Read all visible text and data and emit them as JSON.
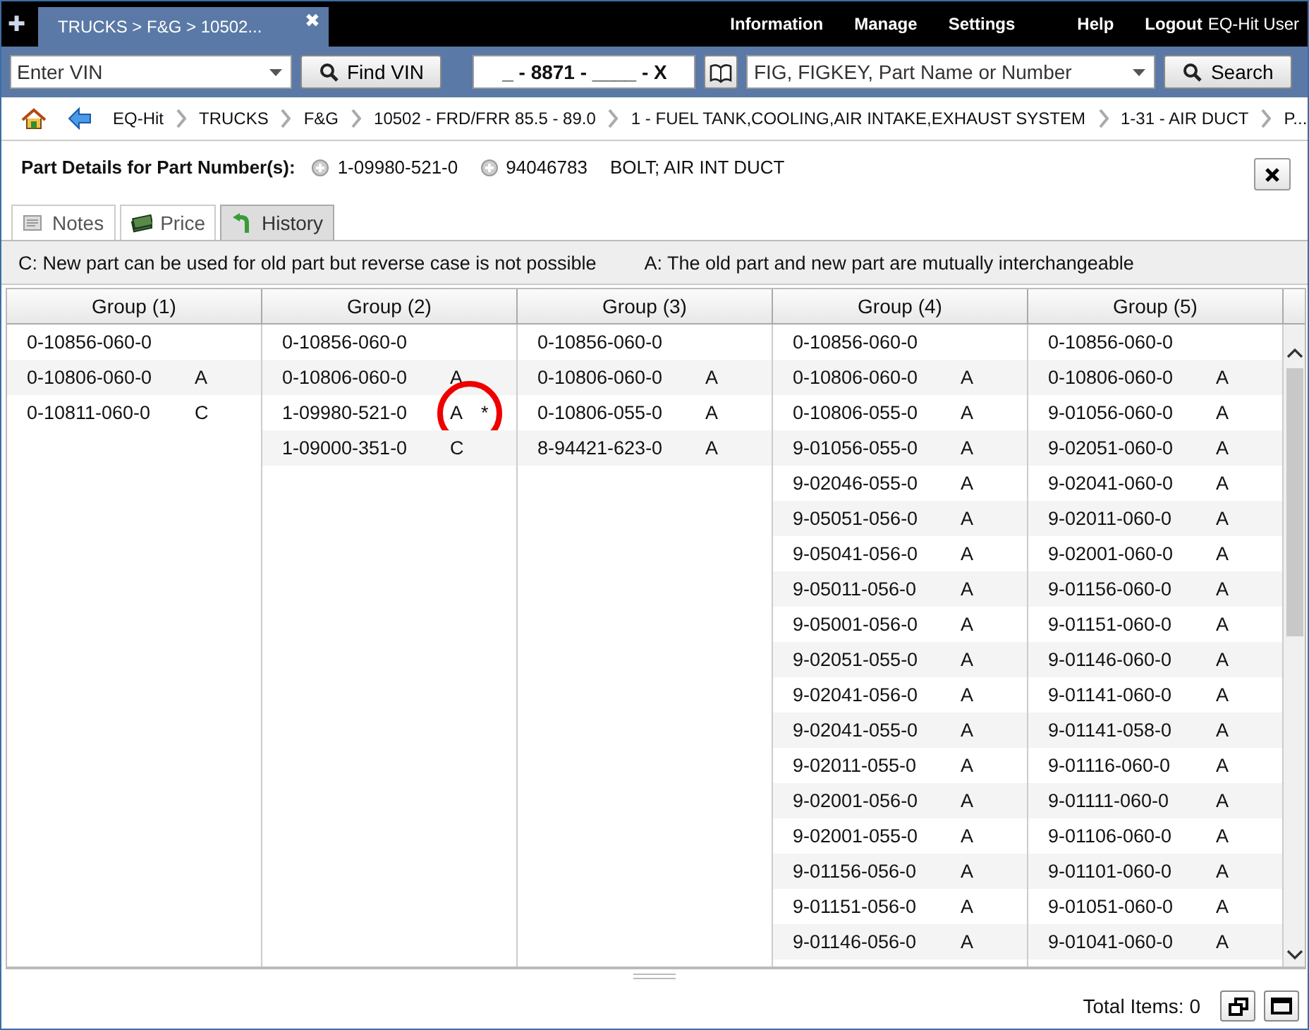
{
  "tab": {
    "title": "TRUCKS > F&G > 10502...",
    "close": "✖"
  },
  "add_tab": "✚",
  "menu": [
    {
      "label": "Information"
    },
    {
      "label": "Manage"
    },
    {
      "label": "Settings"
    },
    {
      "label": "Help"
    },
    {
      "label": "Logout"
    }
  ],
  "user": "EQ-Hit User",
  "vin": {
    "placeholder": "Enter VIN",
    "button": "Find VIN"
  },
  "vin_pattern": "_ - 8871 - ____ - X",
  "part_search": {
    "placeholder": "FIG, FIGKEY, Part Name or Number",
    "button": "Search"
  },
  "breadcrumb": [
    "EQ-Hit",
    "TRUCKS",
    "F&G",
    "10502 - FRD/FRR 85.5 - 89.0",
    "1 - FUEL TANK,COOLING,AIR INTAKE,EXHAUST SYSTEM",
    "1-31 - AIR DUCT",
    "P..."
  ],
  "details": {
    "label": "Part Details for Part Number(s):",
    "numbers": [
      "1-09980-521-0",
      "94046783"
    ],
    "description": "BOLT; AIR INT DUCT"
  },
  "tabs": [
    {
      "label": "Notes",
      "selected": false
    },
    {
      "label": "Price",
      "selected": false
    },
    {
      "label": "History",
      "selected": true
    }
  ],
  "legend": [
    "C: New part can be used for old part but reverse case is not possible",
    "A: The old part and new part are mutually interchangeable"
  ],
  "groups": [
    {
      "header": "Group (1)",
      "rows": [
        {
          "part": "0-10856-060-0"
        },
        {
          "part": "0-10806-060-0",
          "code": "A"
        },
        {
          "part": "0-10811-060-0",
          "code": "C"
        }
      ]
    },
    {
      "header": "Group (2)",
      "rows": [
        {
          "part": "0-10856-060-0"
        },
        {
          "part": "0-10806-060-0",
          "code": "A"
        },
        {
          "part": "1-09980-521-0",
          "code": "A",
          "note": "*",
          "circled": true
        },
        {
          "part": "1-09000-351-0",
          "code": "C"
        }
      ]
    },
    {
      "header": "Group (3)",
      "rows": [
        {
          "part": "0-10856-060-0"
        },
        {
          "part": "0-10806-060-0",
          "code": "A"
        },
        {
          "part": "0-10806-055-0",
          "code": "A"
        },
        {
          "part": "8-94421-623-0",
          "code": "A"
        }
      ]
    },
    {
      "header": "Group (4)",
      "rows": [
        {
          "part": "0-10856-060-0"
        },
        {
          "part": "0-10806-060-0",
          "code": "A"
        },
        {
          "part": "0-10806-055-0",
          "code": "A"
        },
        {
          "part": "9-01056-055-0",
          "code": "A"
        },
        {
          "part": "9-02046-055-0",
          "code": "A"
        },
        {
          "part": "9-05051-056-0",
          "code": "A"
        },
        {
          "part": "9-05041-056-0",
          "code": "A"
        },
        {
          "part": "9-05011-056-0",
          "code": "A"
        },
        {
          "part": "9-05001-056-0",
          "code": "A"
        },
        {
          "part": "9-02051-055-0",
          "code": "A"
        },
        {
          "part": "9-02041-056-0",
          "code": "A"
        },
        {
          "part": "9-02041-055-0",
          "code": "A"
        },
        {
          "part": "9-02011-055-0",
          "code": "A"
        },
        {
          "part": "9-02001-056-0",
          "code": "A"
        },
        {
          "part": "9-02001-055-0",
          "code": "A"
        },
        {
          "part": "9-01156-056-0",
          "code": "A"
        },
        {
          "part": "9-01151-056-0",
          "code": "A"
        },
        {
          "part": "9-01146-056-0",
          "code": "A"
        }
      ]
    },
    {
      "header": "Group (5)",
      "rows": [
        {
          "part": "0-10856-060-0"
        },
        {
          "part": "0-10806-060-0",
          "code": "A"
        },
        {
          "part": "9-01056-060-0",
          "code": "A"
        },
        {
          "part": "9-02051-060-0",
          "code": "A"
        },
        {
          "part": "9-02041-060-0",
          "code": "A"
        },
        {
          "part": "9-02011-060-0",
          "code": "A"
        },
        {
          "part": "9-02001-060-0",
          "code": "A"
        },
        {
          "part": "9-01156-060-0",
          "code": "A"
        },
        {
          "part": "9-01151-060-0",
          "code": "A"
        },
        {
          "part": "9-01146-060-0",
          "code": "A"
        },
        {
          "part": "9-01141-060-0",
          "code": "A"
        },
        {
          "part": "9-01141-058-0",
          "code": "A"
        },
        {
          "part": "9-01116-060-0",
          "code": "A"
        },
        {
          "part": "9-01111-060-0",
          "code": "A"
        },
        {
          "part": "9-01106-060-0",
          "code": "A"
        },
        {
          "part": "9-01101-060-0",
          "code": "A"
        },
        {
          "part": "9-01051-060-0",
          "code": "A"
        },
        {
          "part": "9-01041-060-0",
          "code": "A"
        }
      ]
    }
  ],
  "total": "Total Items: 0"
}
